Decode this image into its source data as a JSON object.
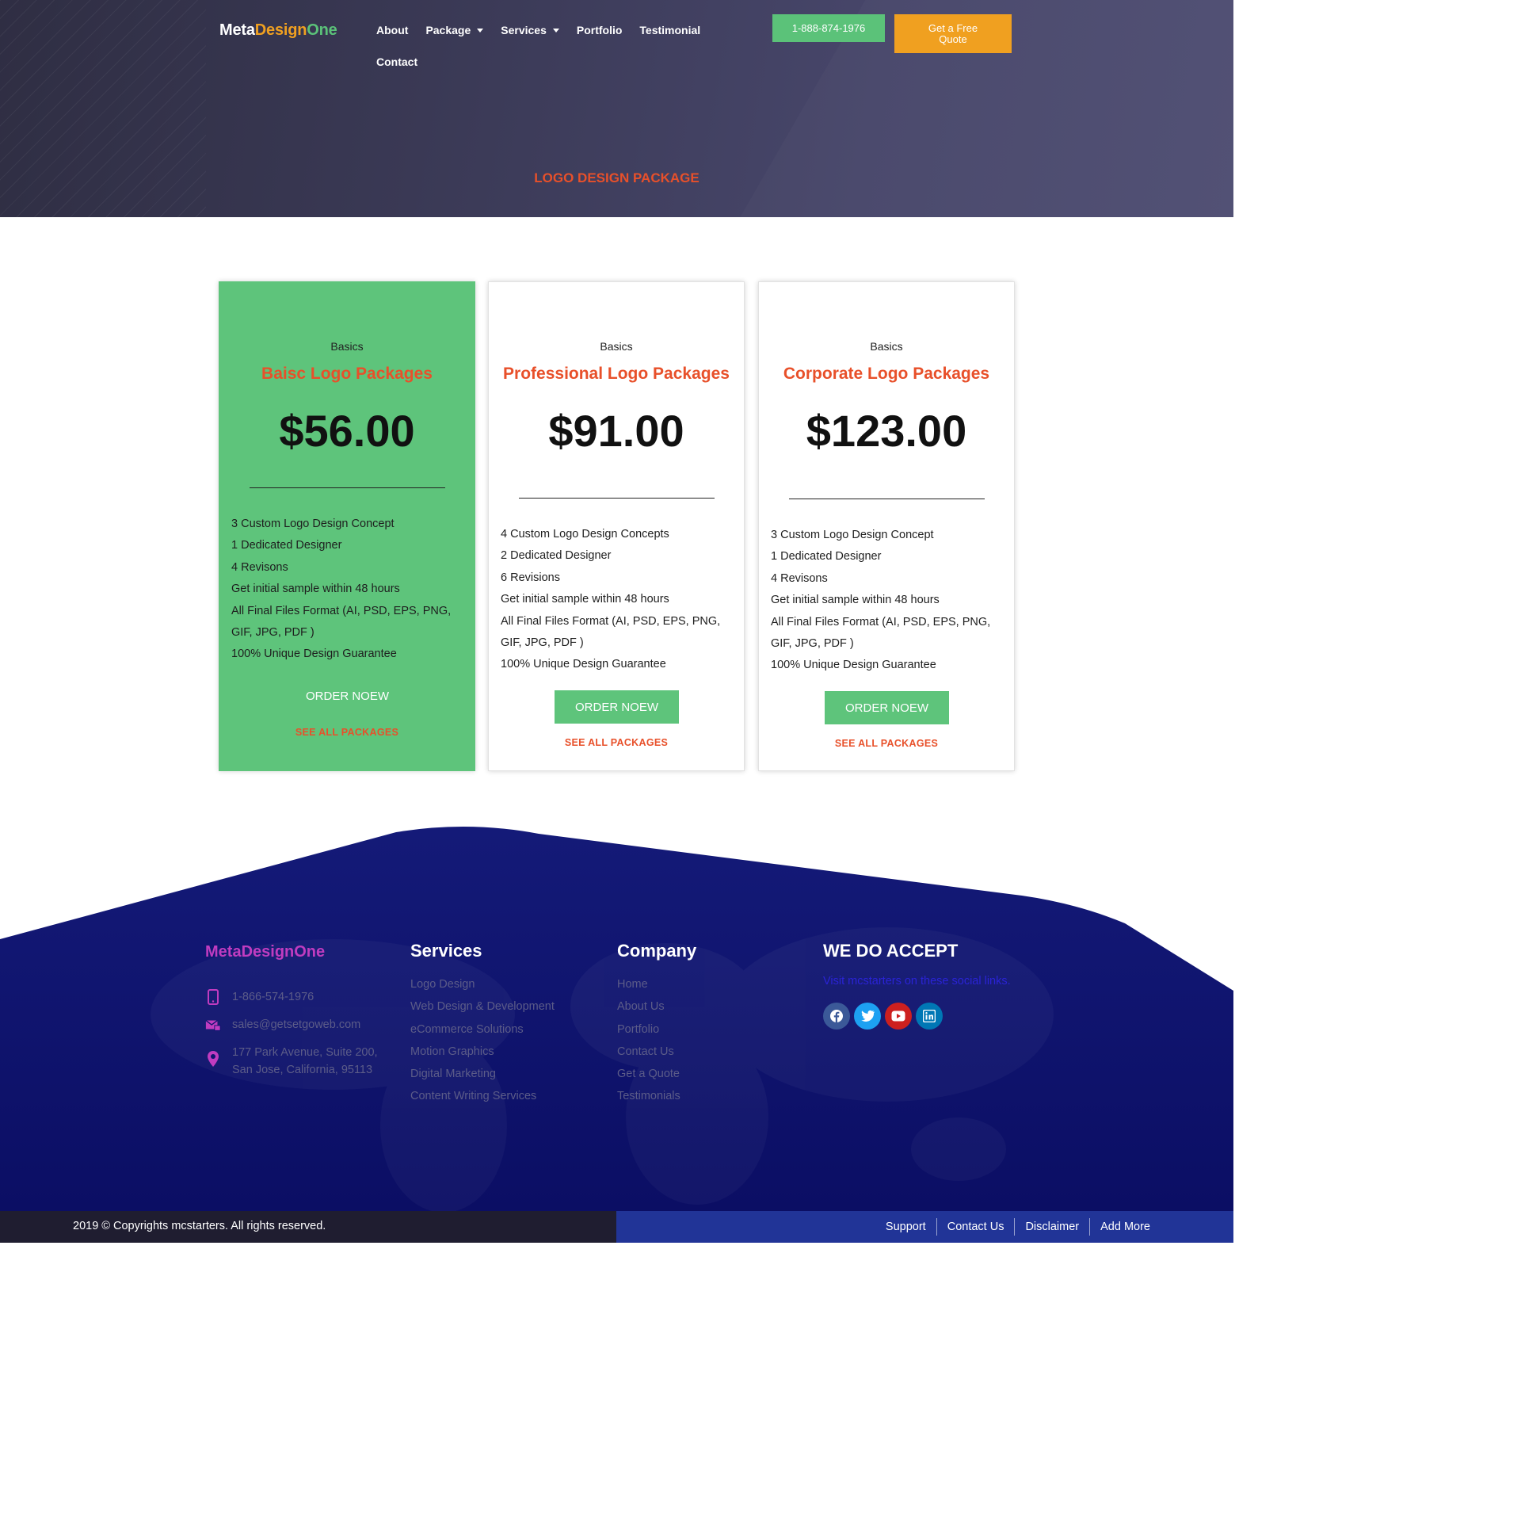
{
  "brand": {
    "part1": "Meta",
    "part2": "Design",
    "part3": "One"
  },
  "nav": {
    "items": [
      {
        "label": "About",
        "dropdown": false
      },
      {
        "label": "Package",
        "dropdown": true
      },
      {
        "label": "Services",
        "dropdown": true
      },
      {
        "label": "Portfolio",
        "dropdown": false
      },
      {
        "label": "Testimonial",
        "dropdown": false
      },
      {
        "label": "Contact",
        "dropdown": false
      }
    ],
    "phone_label": "1-888-874-1976",
    "quote_label": "Get a Free Quote"
  },
  "hero": {
    "title": "LOGO DESIGN PACKAGE"
  },
  "cards": [
    {
      "subtitle": "Basics",
      "title": "Baisc Logo Packages",
      "price": "$56.00",
      "features": [
        "3 Custom Logo Design Concept",
        "1 Dedicated Designer",
        "4 Revisons",
        "Get initial sample within 48 hours",
        "All Final Files Format (AI, PSD, EPS, PNG, GIF, JPG, PDF )",
        "100% Unique Design Guarantee"
      ],
      "order_label": "ORDER NOEW",
      "see_all_label": "SEE ALL PACKAGES"
    },
    {
      "subtitle": "Basics",
      "title": "Professional Logo Packages",
      "price": "$91.00",
      "features": [
        "4 Custom Logo Design Concepts",
        "2 Dedicated Designer",
        "6 Revisions",
        "Get initial sample within 48 hours",
        "All Final Files Format (AI, PSD, EPS, PNG, GIF, JPG, PDF )",
        "100% Unique Design Guarantee"
      ],
      "order_label": "ORDER NOEW",
      "see_all_label": "SEE ALL PACKAGES"
    },
    {
      "subtitle": "Basics",
      "title": "Corporate Logo Packages",
      "price": "$123.00",
      "features": [
        "3 Custom Logo Design Concept",
        "1 Dedicated Designer",
        "4 Revisons",
        "Get initial sample within 48 hours",
        "All Final Files Format (AI, PSD, EPS, PNG, GIF, JPG, PDF )",
        "100% Unique Design Guarantee"
      ],
      "order_label": "ORDER NOEW",
      "see_all_label": "SEE ALL PACKAGES"
    }
  ],
  "footer": {
    "brand": "MetaDesignOne",
    "phone": "1-866-574-1976",
    "email": "sales@getsetgoweb.com",
    "address_line1": "177 Park Avenue, Suite 200,",
    "address_line2": "San Jose, California, 95113",
    "services_heading": "Services",
    "services": [
      "Logo Design",
      "Web Design & Development",
      "eCommerce Solutions",
      "Motion Graphics",
      "Digital Marketing",
      "Content Writing Services"
    ],
    "company_heading": "Company",
    "company": [
      "Home",
      "About Us",
      "Portfolio",
      "Contact Us",
      "Get a Quote",
      "Testimonials"
    ],
    "accept_heading": "WE DO ACCEPT",
    "accept_text": "Visit mcstarters on these social links.",
    "social": [
      {
        "icon": "facebook-icon",
        "color": "#3b5998"
      },
      {
        "icon": "twitter-icon",
        "color": "#1da1f2"
      },
      {
        "icon": "youtube-icon",
        "color": "#cd201f"
      },
      {
        "icon": "linkedin-icon",
        "color": "#0077b5"
      }
    ]
  },
  "bottom_bar": {
    "copyright": "2019 © Copyrights mcstarters. All rights reserved.",
    "links": [
      "Support",
      "Contact Us",
      "Disclaimer",
      "Add More"
    ]
  },
  "colors": {
    "accent_green": "#5ec47b",
    "accent_orange": "#f0a020",
    "accent_red": "#e8502a",
    "footer_navy": "#0f1470"
  }
}
